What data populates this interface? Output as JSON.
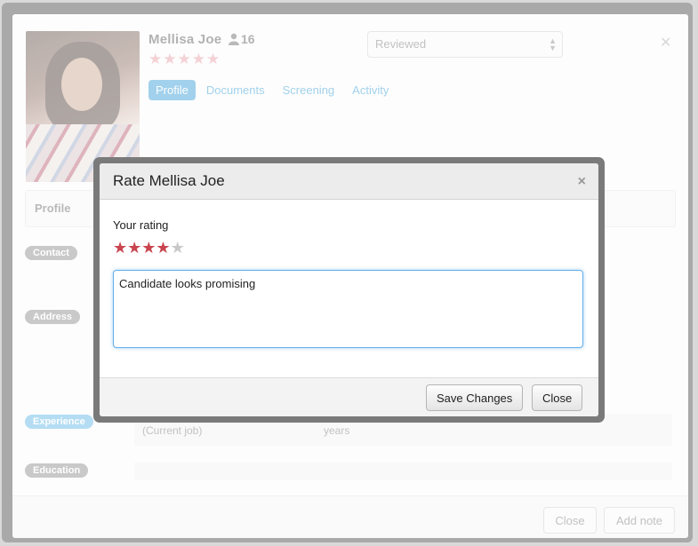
{
  "candidate": {
    "name": "Mellisa  Joe",
    "count": "16",
    "rating_stars": 5,
    "status_select": "Reviewed"
  },
  "tabs": [
    {
      "label": "Profile",
      "active": true
    },
    {
      "label": "Documents",
      "active": false
    },
    {
      "label": "Screening",
      "active": false
    },
    {
      "label": "Activity",
      "active": false
    }
  ],
  "sections": {
    "profile": "Profile",
    "contact": "Contact",
    "address": "Address",
    "experience": "Experience",
    "education": "Education",
    "current_job": "(Current job)",
    "years": "years"
  },
  "footer": {
    "close_label": "Close",
    "add_note_label": "Add note"
  },
  "modal": {
    "title": "Rate Mellisa  Joe",
    "rating_label": "Your rating",
    "rating_value": 4,
    "rating_max": 5,
    "note_value": "Candidate looks promising",
    "save_label": "Save Changes",
    "close_label": "Close"
  },
  "colors": {
    "accent": "#2f9ad6",
    "star_active": "#c9444f",
    "star_inactive": "#c8c8c8"
  },
  "icons": {
    "close": "close-icon",
    "person": "person-icon",
    "star": "star-icon"
  }
}
